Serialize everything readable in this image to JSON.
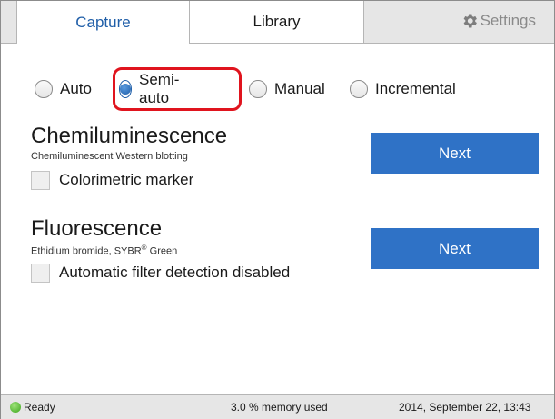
{
  "tabs": {
    "capture": "Capture",
    "library": "Library",
    "settings": "Settings"
  },
  "modes": [
    {
      "label": "Auto",
      "selected": false
    },
    {
      "label": "Semi-auto",
      "selected": true
    },
    {
      "label": "Manual",
      "selected": false
    },
    {
      "label": "Incremental",
      "selected": false
    }
  ],
  "chemi": {
    "title": "Chemiluminescence",
    "subtitle": "Chemiluminescent Western blotting",
    "checkbox_label": "Colorimetric marker",
    "checkbox_checked": false,
    "next_label": "Next"
  },
  "fluor": {
    "title": "Fluorescence",
    "subtitle_pre": "Ethidium bromide, SYBR",
    "subtitle_reg": "®",
    "subtitle_post": " Green",
    "checkbox_label": "Automatic filter detection disabled",
    "checkbox_checked": false,
    "next_label": "Next"
  },
  "status": {
    "state": "Ready",
    "memory": "3.0 % memory used",
    "datetime": "2014, September 22, 13:43"
  },
  "colors": {
    "accent": "#2f72c6",
    "tab_active_text": "#1f5ea8",
    "highlight": "#e0141e",
    "status_ok": "#3ca51c"
  },
  "icons": {
    "settings": "gear-icon",
    "status": "status-led-icon"
  }
}
